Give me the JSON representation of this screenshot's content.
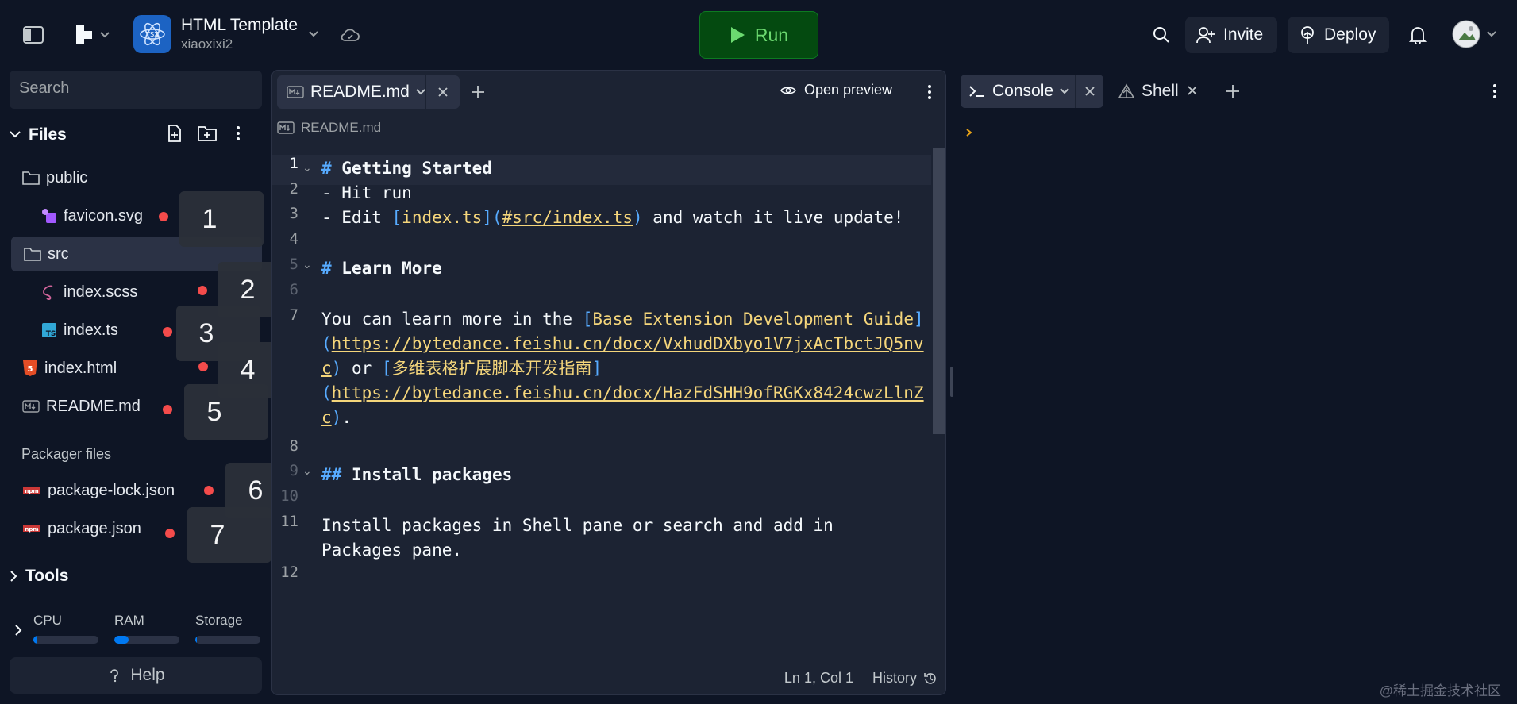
{
  "topbar": {
    "project_name": "HTML Template",
    "project_owner": "xiaoxixi2",
    "run_label": "Run",
    "invite_label": "Invite",
    "deploy_label": "Deploy"
  },
  "sidebar": {
    "search_placeholder": "Search",
    "files_label": "Files",
    "tree": [
      {
        "name": "public",
        "type": "folder"
      },
      {
        "name": "favicon.svg",
        "type": "svg",
        "badge": "1"
      },
      {
        "name": "src",
        "type": "folder"
      },
      {
        "name": "index.scss",
        "type": "scss",
        "badge": "2"
      },
      {
        "name": "index.ts",
        "type": "ts",
        "badge": "3"
      },
      {
        "name": "index.html",
        "type": "html",
        "badge": "4"
      },
      {
        "name": "README.md",
        "type": "md",
        "badge": "5"
      }
    ],
    "packager_label": "Packager files",
    "packager_files": [
      {
        "name": "package-lock.json",
        "badge": "6"
      },
      {
        "name": "package.json",
        "badge": "7"
      }
    ],
    "tools_label": "Tools",
    "resources": [
      {
        "label": "CPU",
        "fill": 0.06
      },
      {
        "label": "RAM",
        "fill": 0.22
      },
      {
        "label": "Storage",
        "fill": 0.02
      }
    ],
    "help_label": "Help"
  },
  "editor": {
    "tab_label": "README.md",
    "open_preview_label": "Open preview",
    "breadcrumb": "README.md",
    "line_numbers": [
      "1",
      "2",
      "3",
      "4",
      "5",
      "6",
      "7",
      "8",
      "9",
      "10",
      "11",
      "12"
    ],
    "code": {
      "l1_mark": "#",
      "l1_text": " Getting Started",
      "l2": "- Hit run",
      "l3_a": "- Edit ",
      "l3_link": "index.ts",
      "l3_url": "#src/index.ts",
      "l3_b": " and watch it live update!",
      "l5_mark": "#",
      "l5_text": " Learn More",
      "l7_a": "You can learn more in the ",
      "l7_link": "Base Extension Development Guide",
      "l7_url_1": "https://bytedance.feishu.cn/docx/VxhudDXbyo1V7jxAcTbctJQ5nv",
      "l7_url_2": "c",
      "l7_or": " or ",
      "l7_link2": "多维表格扩展脚本开发指南",
      "l7_url2_1": "https://bytedance.feishu.cn/docx/HazFdSHH9ofRGKx8424cwzLlnZ",
      "l7_url2_2": "c",
      "l9_mark": "##",
      "l9_text": " Install packages",
      "l11_1": "Install packages in Shell pane or search and add in",
      "l11_2": "Packages pane."
    },
    "status_pos": "Ln 1, Col 1",
    "history_label": "History"
  },
  "console": {
    "tab1_label": "Console",
    "tab2_label": "Shell"
  },
  "watermark": "@稀土掘金技术社区"
}
